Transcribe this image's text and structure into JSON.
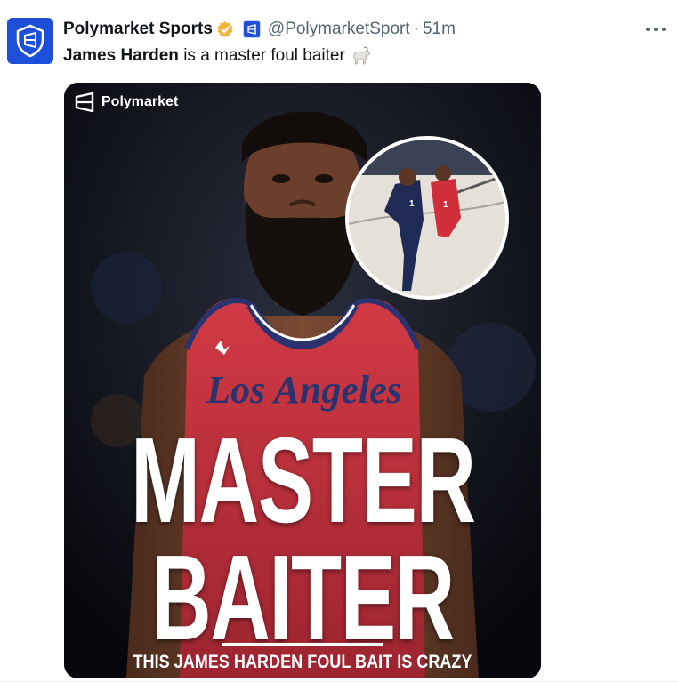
{
  "author": {
    "display_name": "Polymarket Sports",
    "handle": "@PolymarketSport",
    "separator": "·",
    "time": "51m",
    "avatar_icon": "polymarket-shield-icon",
    "verified_icon": "verified-gold-badge-icon",
    "affiliate_icon": "polymarket-affiliate-badge-icon"
  },
  "tweet": {
    "mention": "James Harden",
    "text": "is a master foul baiter",
    "emoji_icon": "goat-icon"
  },
  "media": {
    "brand_label": "Polymarket",
    "headline_line1": "MASTER",
    "headline_line2": "BAITER",
    "caption": "THIS JAMES HARDEN FOUL BAIT IS CRAZY",
    "jersey_text": "Los Angeles"
  },
  "menu": {
    "more_icon": "more-options-icon"
  },
  "colors": {
    "brand_blue": "#1e4fd8",
    "verified_gold": "#f2b43a",
    "secondary_text": "#536471",
    "jersey_red": "#c8303b"
  }
}
